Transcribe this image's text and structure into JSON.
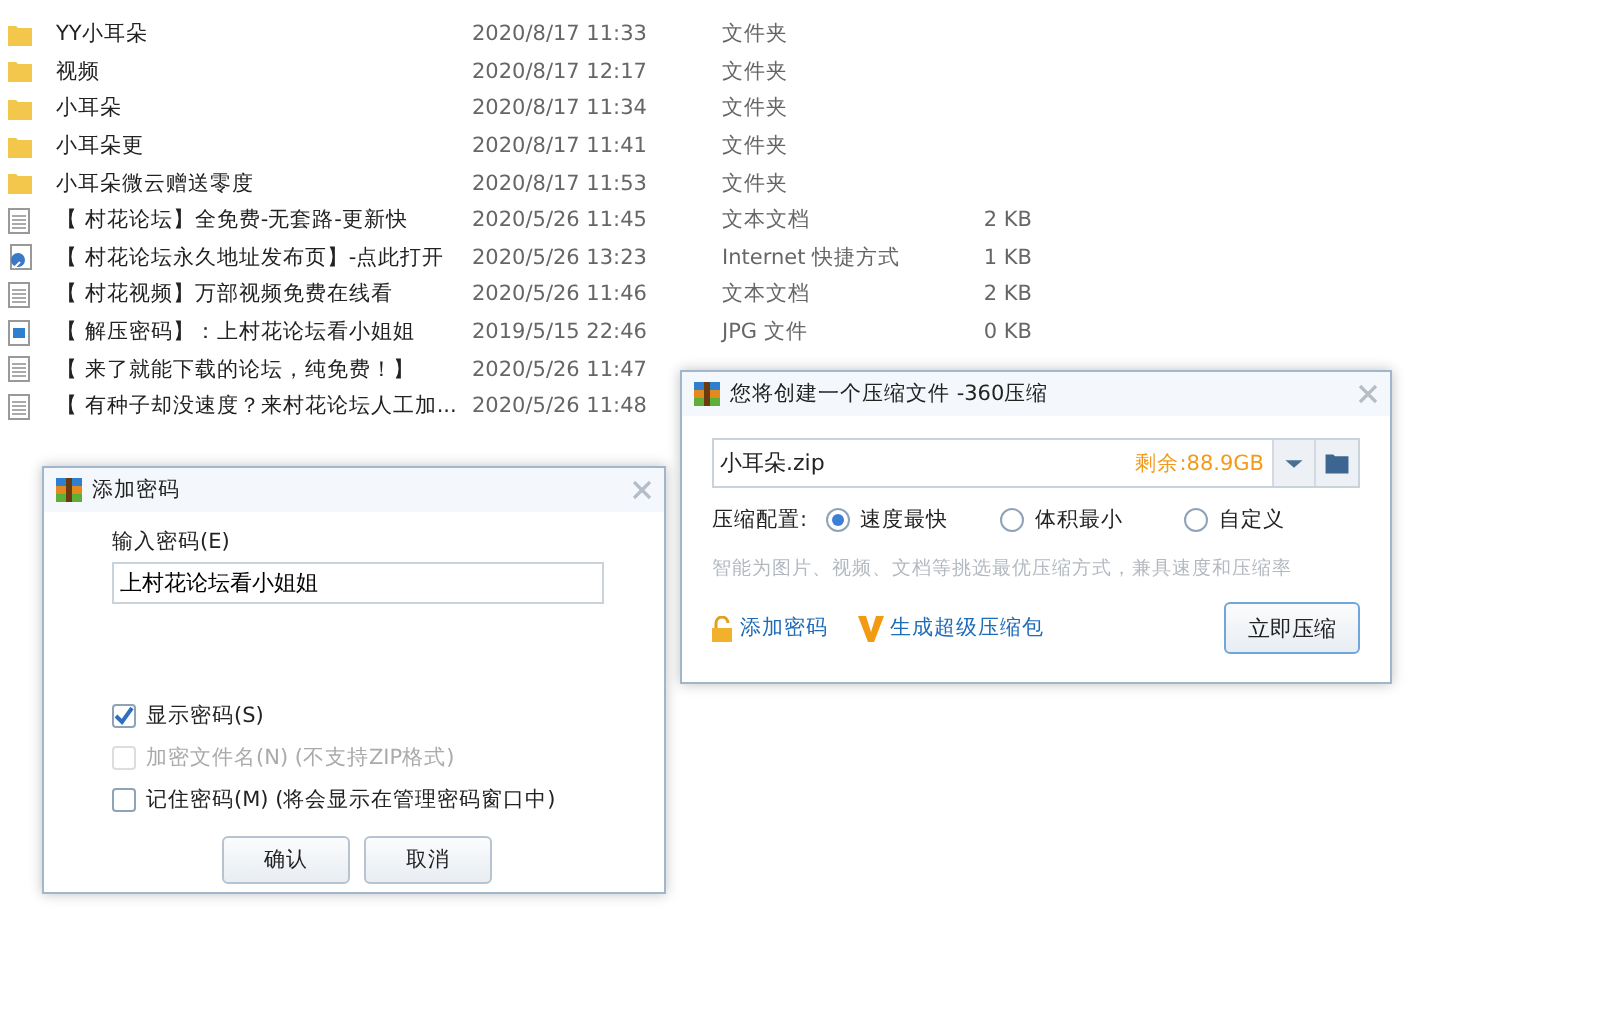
{
  "files": [
    {
      "kind": "folder",
      "name": "YY小耳朵",
      "date": "2020/8/17 11:33",
      "type": "文件夹"
    },
    {
      "kind": "folder",
      "name": "视频",
      "date": "2020/8/17 12:17",
      "type": "文件夹"
    },
    {
      "kind": "folder",
      "name": "小耳朵",
      "date": "2020/8/17 11:34",
      "type": "文件夹"
    },
    {
      "kind": "folder",
      "name": "小耳朵更",
      "date": "2020/8/17 11:41",
      "type": "文件夹"
    },
    {
      "kind": "folder",
      "name": "小耳朵微云赠送零度",
      "date": "2020/8/17 11:53",
      "type": "文件夹"
    },
    {
      "kind": "text",
      "name": "【 村花论坛】全免费-无套路-更新快",
      "date": "2020/5/26 11:45",
      "type": "文本文档",
      "size": "2 KB"
    },
    {
      "kind": "link",
      "name": "【 村花论坛永久地址发布页】-点此打开",
      "date": "2020/5/26 13:23",
      "type": "Internet 快捷方式",
      "size": "1 KB"
    },
    {
      "kind": "text",
      "name": "【 村花视频】万部视频免费在线看",
      "date": "2020/5/26 11:46",
      "type": "文本文档",
      "size": "2 KB"
    },
    {
      "kind": "image",
      "name": "【 解压密码】：上村花论坛看小姐姐",
      "date": "2019/5/15 22:46",
      "type": "JPG 文件",
      "size": "0 KB"
    },
    {
      "kind": "text",
      "name": "【 来了就能下载的论坛，纯免费！】",
      "date": "2020/5/26 11:47"
    },
    {
      "kind": "text",
      "name": "【 有种子却没速度？来村花论坛人工加...",
      "date": "2020/5/26 11:48"
    }
  ],
  "password_dialog": {
    "title": "添加密码",
    "label": "输入密码(E)",
    "value": "上村花论坛看小姐姐",
    "options": [
      {
        "label": "显示密码(S)",
        "checked": true,
        "disabled": false
      },
      {
        "label": "加密文件名(N) (不支持ZIP格式)",
        "checked": false,
        "disabled": true
      },
      {
        "label": "记住密码(M) (将会显示在管理密码窗口中)",
        "checked": false,
        "disabled": false
      }
    ],
    "buttons": [
      "确认",
      "取消"
    ]
  },
  "compress_dialog": {
    "title": "您将创建一个压缩文件 -360压缩",
    "filename": "小耳朵.zip",
    "free_space": "剩余:88.9GB",
    "config_label": "压缩配置:",
    "modes": [
      {
        "label": "速度最快",
        "selected": true
      },
      {
        "label": "体积最小",
        "selected": false
      },
      {
        "label": "自定义",
        "selected": false
      }
    ],
    "hint": "智能为图片、视频、文档等挑选最优压缩方式，兼具速度和压缩率",
    "add_password": "添加密码",
    "super_pack": "生成超级压缩包",
    "button": "立即压缩"
  }
}
